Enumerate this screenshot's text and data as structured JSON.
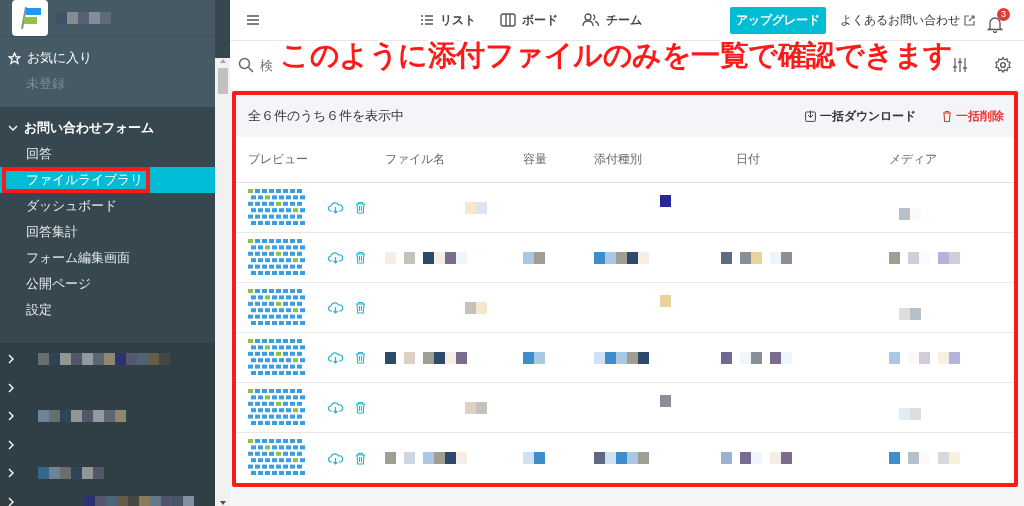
{
  "sidebar": {
    "favorites": {
      "label": "お気に入り",
      "empty_label": "未登録"
    },
    "form": {
      "label": "お問い合わせフォーム",
      "expanded": true,
      "items": [
        {
          "label": "回答",
          "selected": false,
          "highlighted": false
        },
        {
          "label": "ファイルライブラリ",
          "selected": true,
          "highlighted": true
        },
        {
          "label": "ダッシュボード",
          "selected": false,
          "highlighted": false
        },
        {
          "label": "回答集計",
          "selected": false,
          "highlighted": false
        },
        {
          "label": "フォーム編集画面",
          "selected": false,
          "highlighted": false
        },
        {
          "label": "公開ページ",
          "selected": false,
          "highlighted": false
        },
        {
          "label": "設定",
          "selected": false,
          "highlighted": false
        }
      ]
    },
    "other_forms": [
      {
        "expanded": false
      },
      {
        "expanded": false
      },
      {
        "expanded": false
      },
      {
        "expanded": false
      },
      {
        "expanded": false
      },
      {
        "expanded": false
      }
    ]
  },
  "topbar": {
    "nav": [
      {
        "label": "リスト",
        "kind": "list"
      },
      {
        "label": "ボード",
        "kind": "board"
      },
      {
        "label": "チーム",
        "kind": "team"
      }
    ],
    "upgrade": "アップグレード",
    "help": "よくあるお問い合わせ",
    "notifications": "3"
  },
  "search": {
    "placeholder": "検"
  },
  "annotation": "このように添付ファイルのみを一覧で確認できます",
  "table": {
    "highlighted": true,
    "summary": "全６件のうち６件を表示中",
    "download_all": "一括ダウンロード",
    "delete_all": "一括削除",
    "columns": [
      "プレビュー",
      "ファイル名",
      "容量",
      "添付種別",
      "日付",
      "メディア"
    ],
    "rows": [
      {
        "kind": "sparse"
      },
      {
        "kind": "dense"
      },
      {
        "kind": "sparse"
      },
      {
        "kind": "dense"
      },
      {
        "kind": "sparse"
      },
      {
        "kind": "dense"
      }
    ]
  }
}
